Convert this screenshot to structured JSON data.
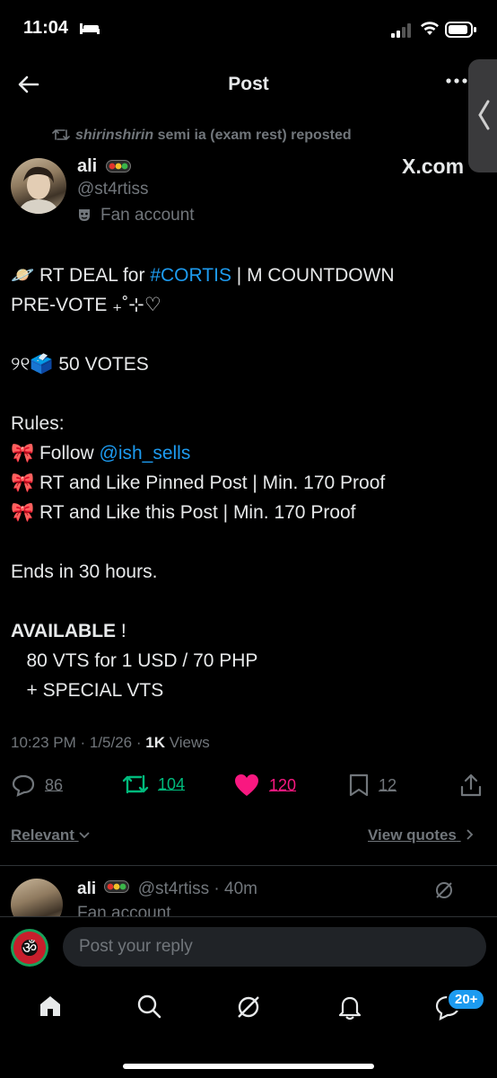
{
  "status_bar": {
    "time": "11:04"
  },
  "header": {
    "title": "Post"
  },
  "repost": {
    "user": "shirinshirin",
    "rest": " semi ia (exam rest) reposted"
  },
  "author": {
    "display_name": "ali",
    "handle": "@st4rtiss",
    "label": "Fan account",
    "watermark": "X.com"
  },
  "post": {
    "line1_pre": "🪐 RT DEAL for ",
    "line1_tag": "#CORTIS",
    "line1_post": "  |  M COUNTDOWN",
    "line2": "PRE-VOTE ₊˚⊹♡",
    "line3": "୨୧🗳️ 50 VOTES",
    "rules_title": "Rules:",
    "rule1_pre": "🎀 Follow ",
    "rule1_link": "@ish_sells",
    "rule2": "🎀 RT and Like Pinned Post | Min. 170 Proof",
    "rule3": "🎀 RT and Like this Post | Min. 170 Proof",
    "ends": "Ends in 30 hours.",
    "available_bold": "AVAILABLE",
    "available_rest": " !",
    "offer1": "   80 VTS for 1 USD / 70 PHP",
    "offer2": "   + SPECIAL VTS"
  },
  "meta": {
    "time": "10:23 PM",
    "date": "1/5/26",
    "views_count": "1K",
    "views_label": "Views"
  },
  "actions": {
    "replies": "86",
    "reposts": "104",
    "likes": "120",
    "bookmarks": "12"
  },
  "sort": {
    "relevant": "Relevant",
    "view_quotes": "View quotes"
  },
  "reply": {
    "name": "ali",
    "handle": "@st4rtiss",
    "age": "40m",
    "label": "Fan account"
  },
  "composer": {
    "placeholder": "Post your reply"
  },
  "nav": {
    "messages_badge": "20+"
  },
  "colors": {
    "accent": "#1d9bf0",
    "repost": "#00ba7c",
    "like": "#f91880"
  }
}
